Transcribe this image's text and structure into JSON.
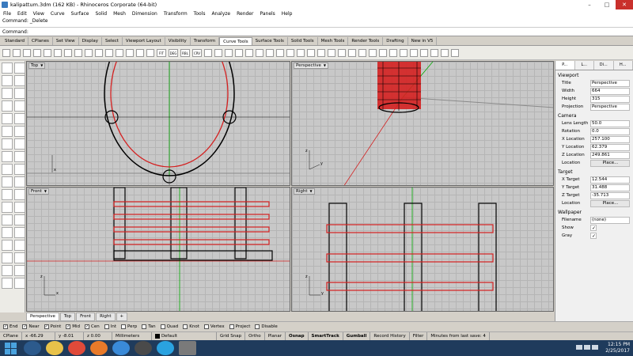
{
  "window": {
    "title": "kalipattum.3dm (162 KB) - Rhinoceros Corporate (64-bit)",
    "min": "–",
    "max": "□",
    "close": "✕"
  },
  "menu": [
    "File",
    "Edit",
    "View",
    "Curve",
    "Surface",
    "Solid",
    "Mesh",
    "Dimension",
    "Transform",
    "Tools",
    "Analyze",
    "Render",
    "Panels",
    "Help"
  ],
  "command": {
    "history": "Command: _Delete",
    "prompt": "Command:"
  },
  "toolbar_tabs": [
    "Standard",
    "CPlanes",
    "Set View",
    "Display",
    "Select",
    "Viewport Layout",
    "Visibility",
    "Transform",
    "Curve Tools",
    "Surface Tools",
    "Solid Tools",
    "Mesh Tools",
    "Render Tools",
    "Drafting",
    "New in V5"
  ],
  "active_toolbar_tab": "Curve Tools",
  "curve_tool_labels": [
    "FIT",
    "DEG",
    "RBL",
    "CRV"
  ],
  "viewports": {
    "top": "Top",
    "perspective": "Perspective",
    "front": "Front",
    "right": "Right"
  },
  "axis_labels": {
    "x": "x",
    "y": "y",
    "z": "z"
  },
  "viewport_tabs": [
    "Perspective",
    "Top",
    "Front",
    "Right"
  ],
  "viewport_tab_add": "+",
  "osnaps": [
    {
      "label": "End",
      "checked": true
    },
    {
      "label": "Near",
      "checked": true
    },
    {
      "label": "Point",
      "checked": true
    },
    {
      "label": "Mid",
      "checked": true
    },
    {
      "label": "Cen",
      "checked": true
    },
    {
      "label": "Int",
      "checked": false
    },
    {
      "label": "Perp",
      "checked": false
    },
    {
      "label": "Tan",
      "checked": false
    },
    {
      "label": "Quad",
      "checked": false
    },
    {
      "label": "Knot",
      "checked": false
    },
    {
      "label": "Vertex",
      "checked": false
    },
    {
      "label": "Project",
      "checked": false
    },
    {
      "label": "Disable",
      "checked": false
    }
  ],
  "status": {
    "cplane": "CPlane",
    "x": "x -66.29",
    "y": "y -8.01",
    "z": "z 0.00",
    "units": "Millimeters",
    "layer": "Default",
    "grid_snap": "Grid Snap",
    "ortho": "Ortho",
    "planar": "Planar",
    "osnap": "Osnap",
    "smarttrack": "SmartTrack",
    "gumball": "Gumball",
    "record_history": "Record History",
    "filter": "Filter",
    "save_msg": "Minutes from last save: 4"
  },
  "panel": {
    "tabs": [
      "P...",
      "L...",
      "Di...",
      "H..."
    ],
    "viewport_section": "Viewport",
    "viewport_rows": [
      {
        "k": "Title",
        "v": "Perspective"
      },
      {
        "k": "Width",
        "v": "664"
      },
      {
        "k": "Height",
        "v": "315"
      },
      {
        "k": "Projection",
        "v": "Perspective"
      }
    ],
    "camera_section": "Camera",
    "camera_rows": [
      {
        "k": "Lens Length",
        "v": "50.0"
      },
      {
        "k": "Rotation",
        "v": "0.0"
      },
      {
        "k": "X Location",
        "v": "257.100"
      },
      {
        "k": "Y Location",
        "v": "62.379"
      },
      {
        "k": "Z Location",
        "v": "249.861"
      },
      {
        "k": "Location",
        "v": "Place..."
      }
    ],
    "target_section": "Target",
    "target_rows": [
      {
        "k": "X Target",
        "v": "12.544"
      },
      {
        "k": "Y Target",
        "v": "31.488"
      },
      {
        "k": "Z Target",
        "v": "-35.713"
      },
      {
        "k": "Location",
        "v": "Place..."
      }
    ],
    "wallpaper_section": "Wallpaper",
    "wallpaper_rows": [
      {
        "k": "Filename",
        "v": "(none)"
      },
      {
        "k": "Show",
        "v": "✓"
      },
      {
        "k": "Gray",
        "v": "✓"
      }
    ]
  },
  "taskbar": {
    "time": "12:15 PM",
    "date": "2/25/2017"
  },
  "colors": {
    "red_curve": "#d42020",
    "black_curve": "#000000",
    "viewport_bg": "#c8c8c8",
    "taskbar": "#1f3b5c"
  }
}
